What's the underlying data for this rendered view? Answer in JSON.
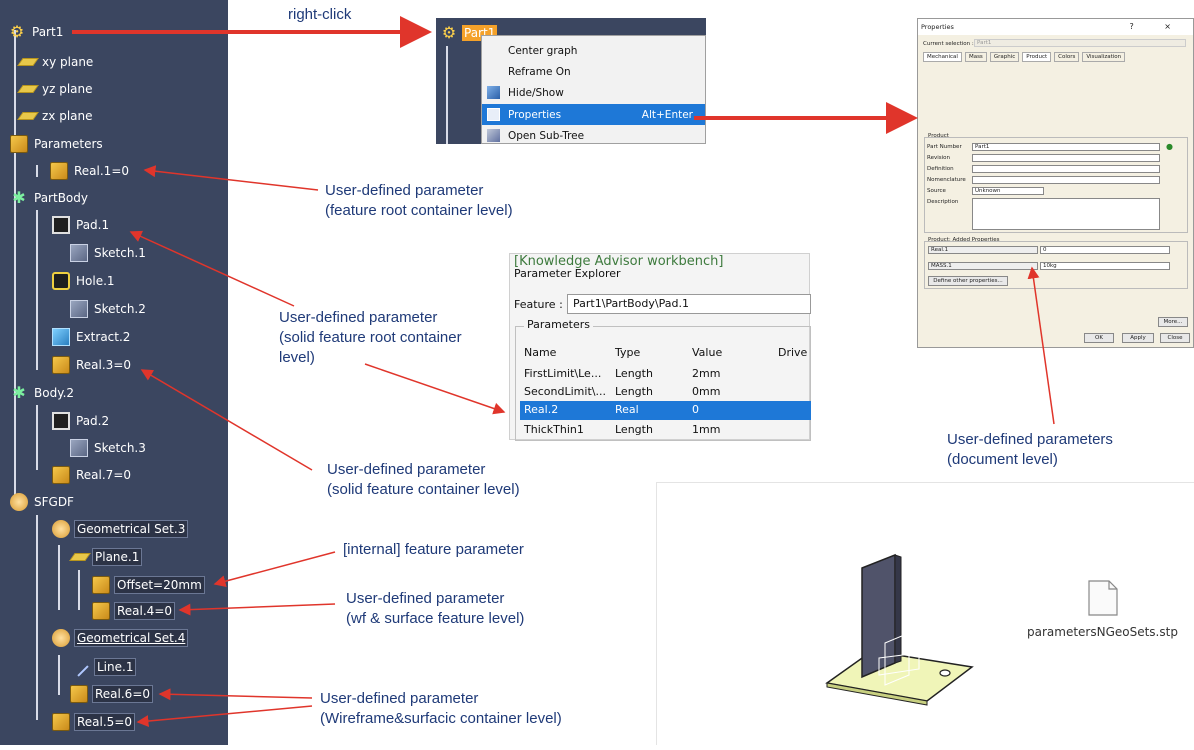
{
  "tree": {
    "nodes": [
      {
        "label": "Part1",
        "icon": "part-icon"
      },
      {
        "label": "xy plane",
        "icon": "plane-icon"
      },
      {
        "label": "yz plane",
        "icon": "plane-icon"
      },
      {
        "label": "zx plane",
        "icon": "plane-icon"
      },
      {
        "label": "Parameters",
        "icon": "parameters-icon"
      },
      {
        "label": "Real.1=0",
        "icon": "parameter-icon"
      },
      {
        "label": "PartBody",
        "icon": "body-icon"
      },
      {
        "label": "Pad.1",
        "icon": "pad-icon"
      },
      {
        "label": "Sketch.1",
        "icon": "sketch-icon"
      },
      {
        "label": "Hole.1",
        "icon": "hole-icon"
      },
      {
        "label": "Sketch.2",
        "icon": "sketch-icon"
      },
      {
        "label": "Extract.2",
        "icon": "extract-icon"
      },
      {
        "label": "Real.3=0",
        "icon": "parameter-icon"
      },
      {
        "label": "Body.2",
        "icon": "body-icon"
      },
      {
        "label": "Pad.2",
        "icon": "pad-icon"
      },
      {
        "label": "Sketch.3",
        "icon": "sketch-icon"
      },
      {
        "label": "Real.7=0",
        "icon": "parameter-icon"
      },
      {
        "label": "SFGDF",
        "icon": "geometrical-set-icon"
      },
      {
        "label": "Geometrical Set.3",
        "icon": "geometrical-set-icon"
      },
      {
        "label": "Plane.1",
        "icon": "plane-icon"
      },
      {
        "label": "Offset=20mm",
        "icon": "parameter-icon"
      },
      {
        "label": "Real.4=0",
        "icon": "parameter-icon"
      },
      {
        "label": "Geometrical Set.4",
        "icon": "geometrical-set-icon"
      },
      {
        "label": "Line.1",
        "icon": "line-icon"
      },
      {
        "label": "Real.6=0",
        "icon": "parameter-icon"
      },
      {
        "label": "Real.5=0",
        "icon": "parameter-icon"
      }
    ]
  },
  "context_menu": {
    "node_label": "Part1",
    "items": [
      {
        "label": "Center graph",
        "shortcut": ""
      },
      {
        "label": "Reframe On",
        "shortcut": ""
      },
      {
        "label": "Hide/Show",
        "shortcut": ""
      },
      {
        "label": "Properties",
        "shortcut": "Alt+Enter"
      },
      {
        "label": "Open Sub-Tree",
        "shortcut": ""
      }
    ]
  },
  "properties_dialog": {
    "title": "Properties",
    "title_buttons": "? ×",
    "current_selection_label": "Current selection :",
    "current_selection_value": "Part1",
    "tabs": [
      "Mechanical",
      "Mass",
      "Graphic",
      "Product",
      "Colors",
      "Visualization"
    ],
    "product_group": "Product",
    "fields": [
      {
        "label": "Part Number",
        "value": "Part1"
      },
      {
        "label": "Revision",
        "value": ""
      },
      {
        "label": "Definition",
        "value": ""
      },
      {
        "label": "Nomenclature",
        "value": ""
      },
      {
        "label": "Source",
        "value": "Unknown"
      },
      {
        "label": "Description",
        "value": ""
      }
    ],
    "added_group": "Product: Added Properties",
    "added_properties": [
      {
        "name": "Real.1",
        "value": "0"
      },
      {
        "name": "MASS.1",
        "value": "10kg"
      }
    ],
    "define_button": "Define other properties...",
    "more_button": "More...",
    "ok_button": "OK",
    "apply_button": "Apply",
    "close_button": "Close"
  },
  "parameter_explorer": {
    "workbench": "[Knowledge Advisor workbench]",
    "title": "Parameter Explorer",
    "feature_label": "Feature :",
    "feature_value": "Part1\\PartBody\\Pad.1",
    "group_label": "Parameters",
    "columns": [
      "Name",
      "Type",
      "Value",
      "Drive"
    ],
    "rows": [
      {
        "name": "FirstLimit\\Le...",
        "type": "Length",
        "value": "2mm"
      },
      {
        "name": "SecondLimit\\...",
        "type": "Length",
        "value": "0mm"
      },
      {
        "name": "Real.2",
        "type": "Real",
        "value": "0",
        "selected": true
      },
      {
        "name": "ThickThin1",
        "type": "Length",
        "value": "1mm"
      }
    ]
  },
  "viewer": {
    "file_name": "parametersNGeoSets.stp"
  },
  "annotations": {
    "right_click": "right-click",
    "a1": [
      "User-defined parameter",
      "(feature root container level)"
    ],
    "a2": [
      "User-defined parameter",
      "(solid feature root container",
      "level)"
    ],
    "a3": [
      "User-defined parameter",
      "(solid feature container level)"
    ],
    "a4": [
      "[internal] feature parameter"
    ],
    "a5": [
      "User-defined parameter",
      "(wf & surface feature level)"
    ],
    "a6": [
      "User-defined parameter",
      "(Wireframe&surfacic container level)"
    ],
    "a7": [
      "User-defined parameters",
      "(document level)"
    ]
  },
  "colors": {
    "tree_bg": "#3b4660",
    "highlight": "#f4a12a",
    "selection": "#1e78d7",
    "arrow": "#e0352b",
    "annotation_text": "#1f3a78"
  }
}
